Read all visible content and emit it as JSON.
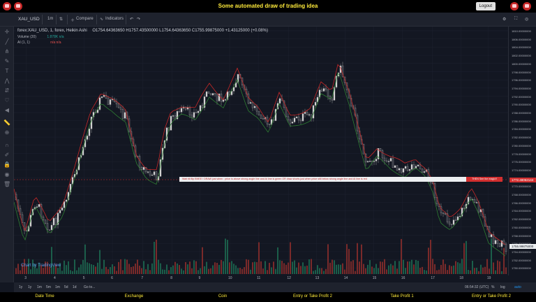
{
  "header": {
    "title": "Some automated draw of trading idea",
    "logout_label": "Logout"
  },
  "toolbar": {
    "symbol": "XAU_USD",
    "interval": "1m",
    "compare_label": "Compare",
    "indicators_label": "Indicators"
  },
  "legend": {
    "main": "forex:XAU_USD, 1, forex, Heikin Ashi",
    "ohlc": "O1754.64363650  H1757.43500000  L1754.64363650  C1755.99875000  +1.43125000 (+0.08%)",
    "volume": "Volume (20)",
    "volume_val": "1.878K  n/a",
    "ai": "AI (1, 1)",
    "ai_val": "n/a  n/a"
  },
  "banner": {
    "text": "Wait till flip EMEE !     DRAW just when : price is above strong angle line and AI line is green         OR       draw shorts just when price still below strong angle line and AI line is red",
    "end": "THEN See the magic!!"
  },
  "price_axis": {
    "ticks": [
      "1810.00000000",
      "1806.00000000",
      "1804.00000000",
      "1802.00000000",
      "1800.00000000",
      "1798.00000000",
      "1796.00000000",
      "1794.00000000",
      "1792.00000000",
      "1790.00000000",
      "1788.00000000",
      "1786.00000000",
      "1784.00000000",
      "1782.00000000",
      "1780.00000000",
      "1778.00000000",
      "1776.00000000",
      "1774.00000000",
      "1772.00000000",
      "1770.00000000",
      "1768.00000000",
      "1766.00000000",
      "1764.00000000",
      "1762.00000000",
      "1760.00000000",
      "1758.00000000",
      "1756.00000000",
      "1754.00000000",
      "1752.00000000",
      "1750.00000000"
    ],
    "red_tag": "1772.48062144",
    "white_tag": "1755.99875000"
  },
  "time_axis": {
    "ticks": [
      "3",
      "4",
      "5",
      "6",
      "7",
      "8",
      "9",
      "10",
      "11",
      "12",
      "13",
      "14",
      "15",
      "16",
      "17",
      "18",
      "19"
    ]
  },
  "bottom": {
    "ranges": [
      "1y",
      "1y",
      "1m",
      "5m",
      "1m",
      "5d",
      "1d",
      "Go to..."
    ],
    "clock": "06:54:32 (UTC)",
    "pct": "%",
    "log": "log",
    "auto": "auto"
  },
  "watermark": "Chart by TradingView",
  "footer": [
    "Date Time",
    "Exchange",
    "Coin",
    "Entry or Take Profit 2",
    "Take Profit 1",
    "Entry or Take Profit 2"
  ],
  "colors": {
    "up": "#26a69a",
    "down": "#ef5350",
    "bg": "#131722",
    "accent": "#ffeb3b"
  }
}
